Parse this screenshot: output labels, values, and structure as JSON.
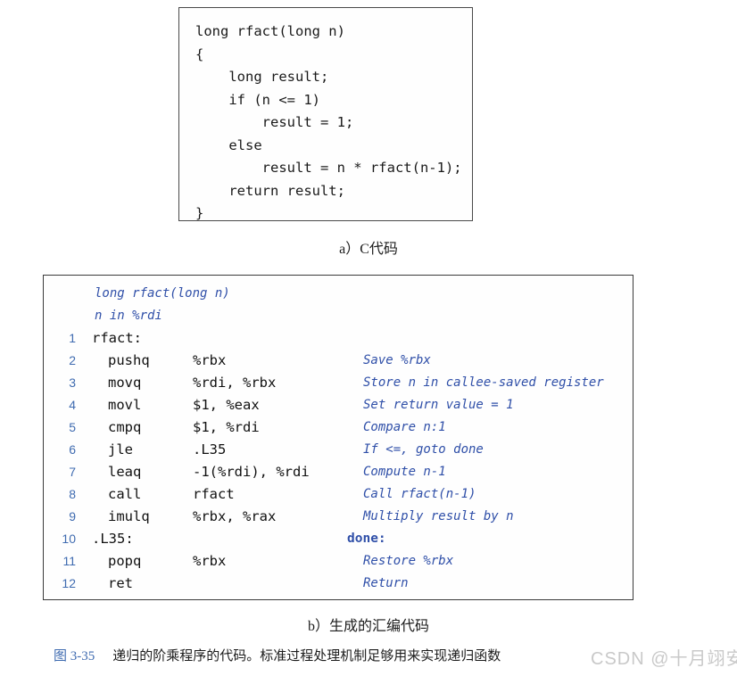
{
  "panel_a": {
    "caption": "a）C代码",
    "code_lines": [
      "long rfact(long n)",
      "{",
      "    long result;",
      "    if (n <= 1)",
      "        result = 1;",
      "    else",
      "        result = n * rfact(n-1);",
      "    return result;",
      "}"
    ]
  },
  "panel_b": {
    "caption": "b）生成的汇编代码",
    "header_lines": [
      "long rfact(long n)",
      "n in %rdi"
    ],
    "rows": [
      {
        "num": "1",
        "label": "rfact:",
        "op": "",
        "args": "",
        "comment": "",
        "comment_plain": false
      },
      {
        "num": "2",
        "label": "",
        "op": "pushq",
        "args": "%rbx",
        "comment": "Save %rbx",
        "comment_plain": false
      },
      {
        "num": "3",
        "label": "",
        "op": "movq",
        "args": "%rdi, %rbx",
        "comment": "Store n in callee-saved register",
        "comment_plain": false
      },
      {
        "num": "4",
        "label": "",
        "op": "movl",
        "args": "$1, %eax",
        "comment": "Set return value = 1",
        "comment_plain": false
      },
      {
        "num": "5",
        "label": "",
        "op": "cmpq",
        "args": "$1, %rdi",
        "comment": "Compare n:1",
        "comment_plain": false
      },
      {
        "num": "6",
        "label": "",
        "op": "jle",
        "args": ".L35",
        "comment": "If <=, goto done",
        "comment_plain": false
      },
      {
        "num": "7",
        "label": "",
        "op": "leaq",
        "args": "-1(%rdi), %rdi",
        "comment": "Compute n-1",
        "comment_plain": false
      },
      {
        "num": "8",
        "label": "",
        "op": "call",
        "args": "rfact",
        "comment": "Call rfact(n-1)",
        "comment_plain": false
      },
      {
        "num": "9",
        "label": "",
        "op": "imulq",
        "args": "%rbx, %rax",
        "comment": "Multiply result by n",
        "comment_plain": false
      },
      {
        "num": "10",
        "label": ".L35:",
        "op": "",
        "args": "",
        "comment": "done:",
        "comment_plain": true
      },
      {
        "num": "11",
        "label": "",
        "op": "popq",
        "args": "%rbx",
        "comment": "Restore %rbx",
        "comment_plain": false
      },
      {
        "num": "12",
        "label": "",
        "op": "ret",
        "args": "",
        "comment": "Return",
        "comment_plain": false
      }
    ]
  },
  "figure_caption": {
    "number": "图 3-35",
    "text": "递归的阶乘程序的代码。标准过程处理机制足够用来实现递归函数"
  },
  "watermark": {
    "text": "CSDN @十月翊安"
  },
  "colors": {
    "accent_blue": "#3f6bb0",
    "comment_blue": "#2f4fa8",
    "ink": "#1a1a1a",
    "border": "#3a3a3a",
    "watermark": "#c9c9c9"
  }
}
